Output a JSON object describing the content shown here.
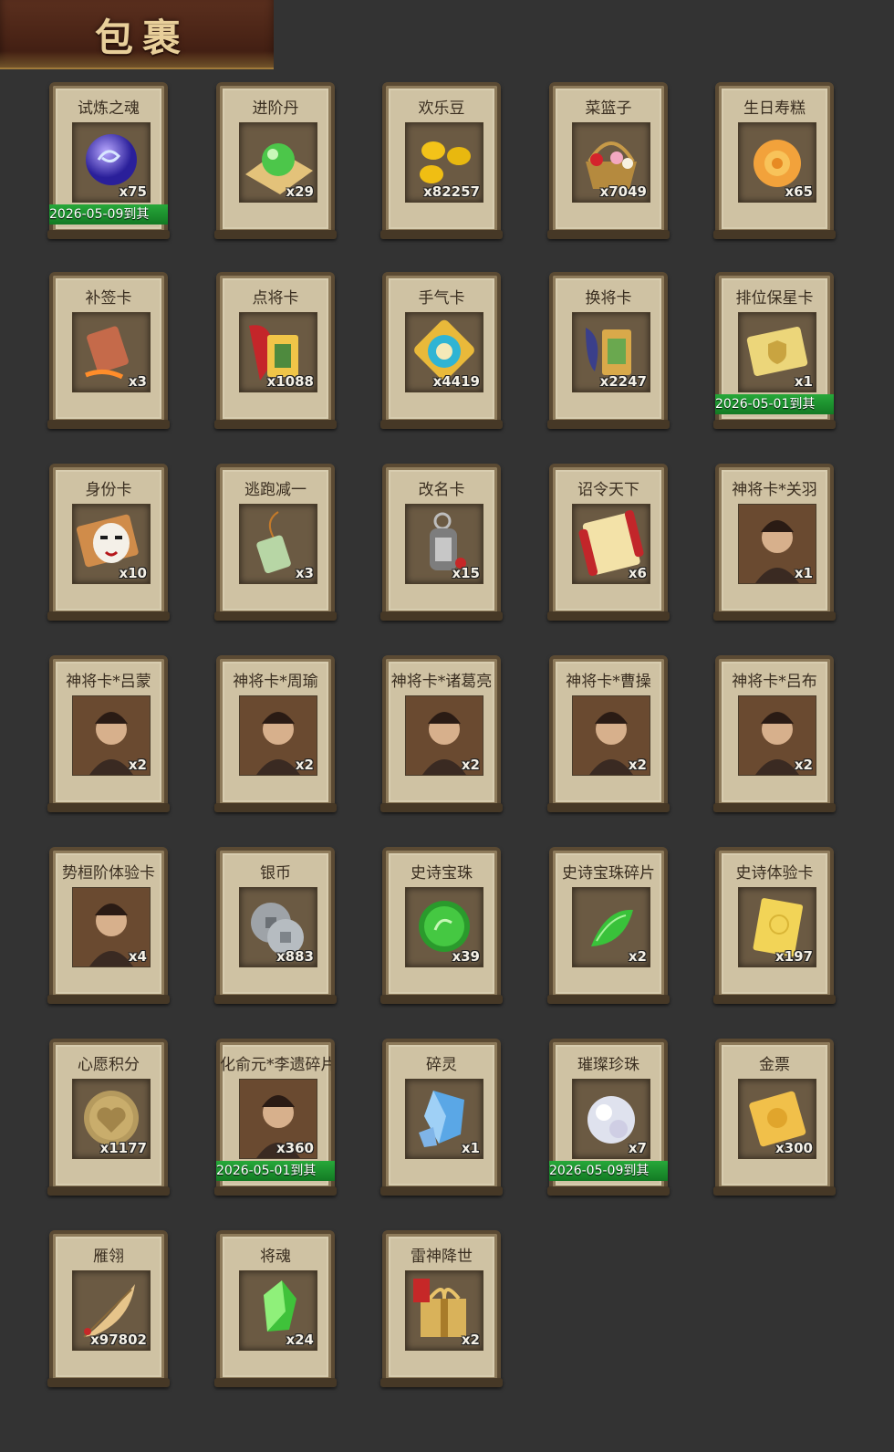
{
  "header": {
    "title": "包裹"
  },
  "items": [
    {
      "name": "试炼之魂",
      "qty": "x75",
      "icon": "dragon-orb-icon",
      "expiry": "2026-05-09到其"
    },
    {
      "name": "进阶丹",
      "qty": "x29",
      "icon": "green-pill-icon"
    },
    {
      "name": "欢乐豆",
      "qty": "x82257",
      "icon": "gold-beans-icon"
    },
    {
      "name": "菜篮子",
      "qty": "x7049",
      "icon": "flower-basket-icon"
    },
    {
      "name": "生日寿糕",
      "qty": "x65",
      "icon": "birthday-cake-icon"
    },
    {
      "name": "补签卡",
      "qty": "x3",
      "icon": "sign-card-icon"
    },
    {
      "name": "点将卡",
      "qty": "x1088",
      "icon": "general-card-icon"
    },
    {
      "name": "手气卡",
      "qty": "x4419",
      "icon": "luck-card-icon"
    },
    {
      "name": "换将卡",
      "qty": "x2247",
      "icon": "swap-card-icon"
    },
    {
      "name": "排位保星卡",
      "qty": "x1",
      "icon": "star-shield-card-icon",
      "expiry": "2026-05-01到其"
    },
    {
      "name": "身份卡",
      "qty": "x10",
      "icon": "mask-card-icon"
    },
    {
      "name": "逃跑减一",
      "qty": "x3",
      "icon": "jade-tag-icon"
    },
    {
      "name": "改名卡",
      "qty": "x15",
      "icon": "name-tag-icon"
    },
    {
      "name": "诏令天下",
      "qty": "x6",
      "icon": "edict-scroll-icon"
    },
    {
      "name": "神将卡*关羽",
      "qty": "x1",
      "icon": "general-portrait-icon"
    },
    {
      "name": "神将卡*吕蒙",
      "qty": "x2",
      "icon": "general-portrait-icon"
    },
    {
      "name": "神将卡*周瑜",
      "qty": "x2",
      "icon": "general-portrait-icon"
    },
    {
      "name": "神将卡*诸葛亮",
      "qty": "x2",
      "icon": "general-portrait-icon"
    },
    {
      "name": "神将卡*曹操",
      "qty": "x2",
      "icon": "general-portrait-icon"
    },
    {
      "name": "神将卡*吕布",
      "qty": "x2",
      "icon": "general-portrait-icon"
    },
    {
      "name": "势桓阶体验卡",
      "qty": "x4",
      "icon": "general-portrait-icon"
    },
    {
      "name": "银币",
      "qty": "x883",
      "icon": "silver-coins-icon"
    },
    {
      "name": "史诗宝珠",
      "qty": "x39",
      "icon": "green-orb-icon"
    },
    {
      "name": "史诗宝珠碎片",
      "qty": "x2",
      "icon": "green-shard-icon"
    },
    {
      "name": "史诗体验卡",
      "qty": "x197",
      "icon": "gold-card-icon"
    },
    {
      "name": "心愿积分",
      "qty": "x1177",
      "icon": "heart-coin-icon"
    },
    {
      "name": "化俞元*李遗碎片",
      "qty": "x360",
      "icon": "general-portrait-icon",
      "expiry": "2026-05-01到其"
    },
    {
      "name": "碎灵",
      "qty": "x1",
      "icon": "blue-crystal-icon"
    },
    {
      "name": "璀璨珍珠",
      "qty": "x7",
      "icon": "pearl-icon",
      "expiry": "2026-05-09到其"
    },
    {
      "name": "金票",
      "qty": "x300",
      "icon": "gold-ticket-icon"
    },
    {
      "name": "雁翎",
      "qty": "x97802",
      "icon": "feather-icon"
    },
    {
      "name": "将魂",
      "qty": "x24",
      "icon": "green-crystal-icon"
    },
    {
      "name": "雷神降世",
      "qty": "x2",
      "icon": "gift-box-icon"
    }
  ]
}
